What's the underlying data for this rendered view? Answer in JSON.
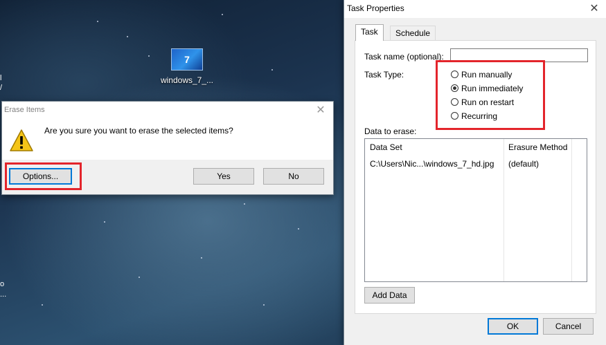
{
  "desktop": {
    "icon_label": "windows_7_...",
    "icon_badge": "7",
    "edge_glyphs": [
      "l",
      "/",
      "o",
      "..."
    ]
  },
  "erase_dialog": {
    "title": "Erase Items",
    "message": "Are you sure you want to erase the selected items?",
    "options_label": "Options...",
    "yes_label": "Yes",
    "no_label": "No",
    "close_glyph": "✕"
  },
  "task_dialog": {
    "title": "Task Properties",
    "close_glyph": "✕",
    "tabs": [
      {
        "label": "Task",
        "active": true
      },
      {
        "label": "Schedule",
        "active": false
      }
    ],
    "task_name_label": "Task name (optional):",
    "task_name_value": "",
    "task_type_label": "Task Type:",
    "task_types": [
      {
        "label": "Run manually",
        "checked": false
      },
      {
        "label": "Run immediately",
        "checked": true
      },
      {
        "label": "Run on restart",
        "checked": false
      },
      {
        "label": "Recurring",
        "checked": false
      }
    ],
    "data_label": "Data to erase:",
    "columns": [
      "Data Set",
      "Erasure Method"
    ],
    "rows": [
      {
        "data_set": "C:\\Users\\Nic...\\windows_7_hd.jpg",
        "method": "(default)"
      }
    ],
    "add_data_label": "Add Data",
    "ok_label": "OK",
    "cancel_label": "Cancel"
  },
  "colors": {
    "highlight": "#e3242b",
    "focus_border": "#0078d7"
  }
}
